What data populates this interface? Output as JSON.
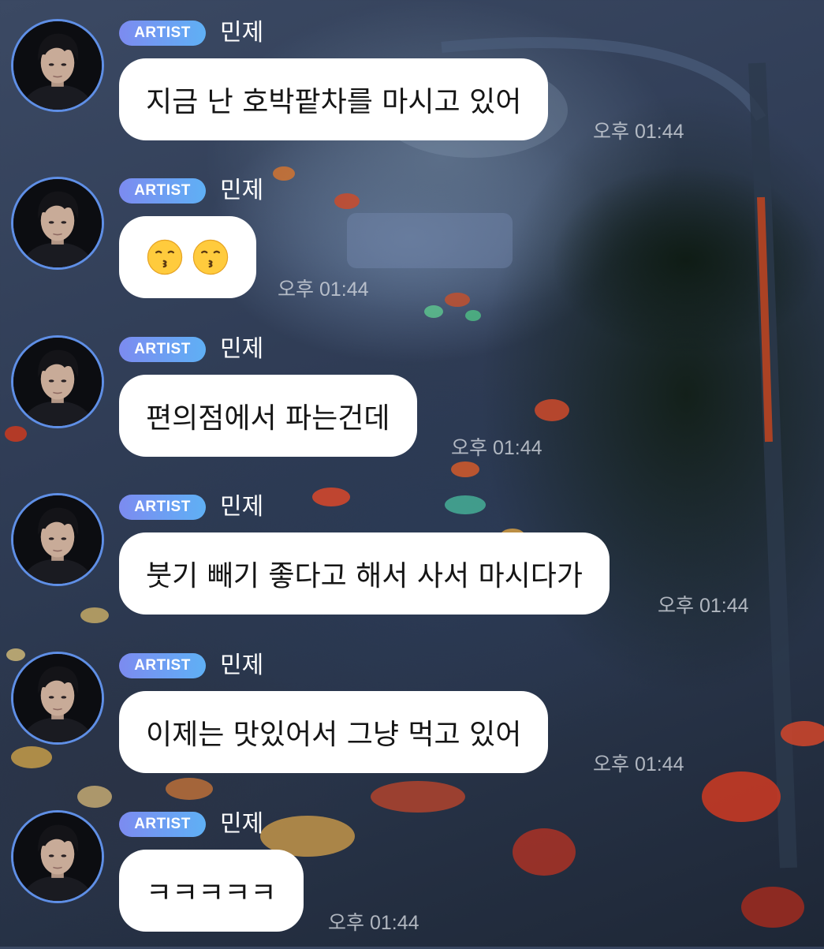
{
  "messages": [
    {
      "badge": "ARTIST",
      "name": "민제",
      "text": "지금 난 호박팥차를 마시고 있어",
      "time": "오후 01:44"
    },
    {
      "badge": "ARTIST",
      "name": "민제",
      "emojis": [
        "kissing-face-icon",
        "kissing-face-icon"
      ],
      "time": "오후 01:44"
    },
    {
      "badge": "ARTIST",
      "name": "민제",
      "text": "편의점에서 파는건데",
      "time": "오후 01:44"
    },
    {
      "badge": "ARTIST",
      "name": "민제",
      "text": "붓기 빼기 좋다고 해서 사서 마시다가",
      "time": "오후 01:44"
    },
    {
      "badge": "ARTIST",
      "name": "민제",
      "text": "이제는 맛있어서 그냥 먹고 있어",
      "time": "오후 01:44"
    },
    {
      "badge": "ARTIST",
      "name": "민제",
      "text": "ㅋㅋㅋㅋㅋ",
      "time": "오후 01:44"
    }
  ],
  "colors": {
    "badge_start": "#7c8bf0",
    "badge_end": "#5fb0f5",
    "avatar_ring": "#5f8fe6",
    "bubble": "#ffffff",
    "bubble_text": "#151515",
    "timestamp": "#d0d4dc"
  }
}
